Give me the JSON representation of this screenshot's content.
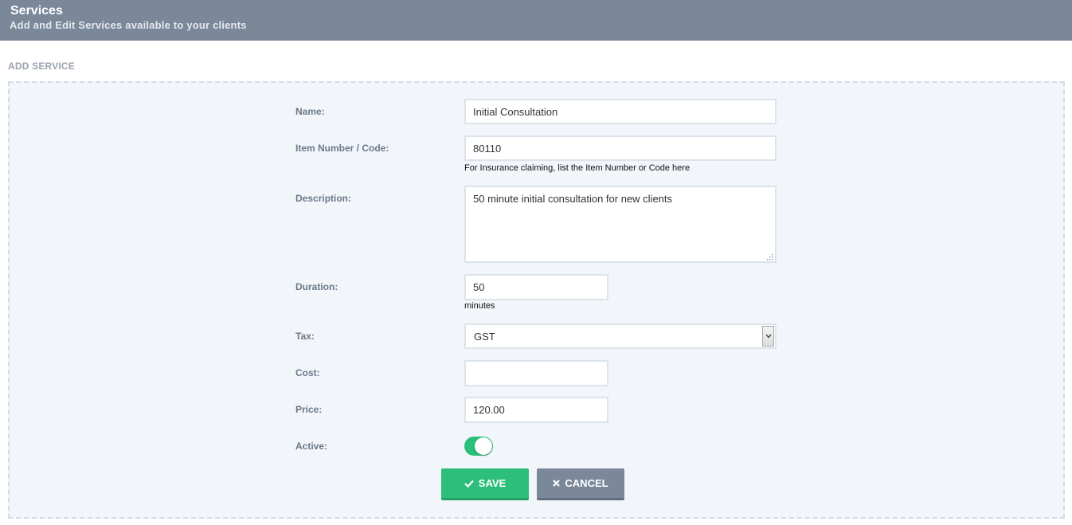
{
  "header": {
    "title": "Services",
    "subtitle": "Add and Edit Services available to your clients"
  },
  "section": {
    "title": "ADD SERVICE"
  },
  "form": {
    "name": {
      "label": "Name:",
      "value": "Initial Consultation"
    },
    "item_code": {
      "label": "Item Number / Code:",
      "value": "80110",
      "help": "For Insurance claiming, list the Item Number or Code here"
    },
    "description": {
      "label": "Description:",
      "value": "50 minute initial consultation for new clients"
    },
    "duration": {
      "label": "Duration:",
      "value": "50",
      "unit": "minutes"
    },
    "tax": {
      "label": "Tax:",
      "selected": "GST"
    },
    "cost": {
      "label": "Cost:",
      "value": ""
    },
    "price": {
      "label": "Price:",
      "value": "120.00"
    },
    "active": {
      "label": "Active:",
      "on": true
    }
  },
  "buttons": {
    "save_label": "SAVE",
    "cancel_label": "CANCEL"
  },
  "icons": {
    "save": "check-icon",
    "cancel": "x-icon",
    "select_arrow": "chevron-down-icon"
  },
  "colors": {
    "header_bg": "#7a8899",
    "accent_green": "#2cbf7a",
    "panel_bg": "#f2f5fa"
  }
}
